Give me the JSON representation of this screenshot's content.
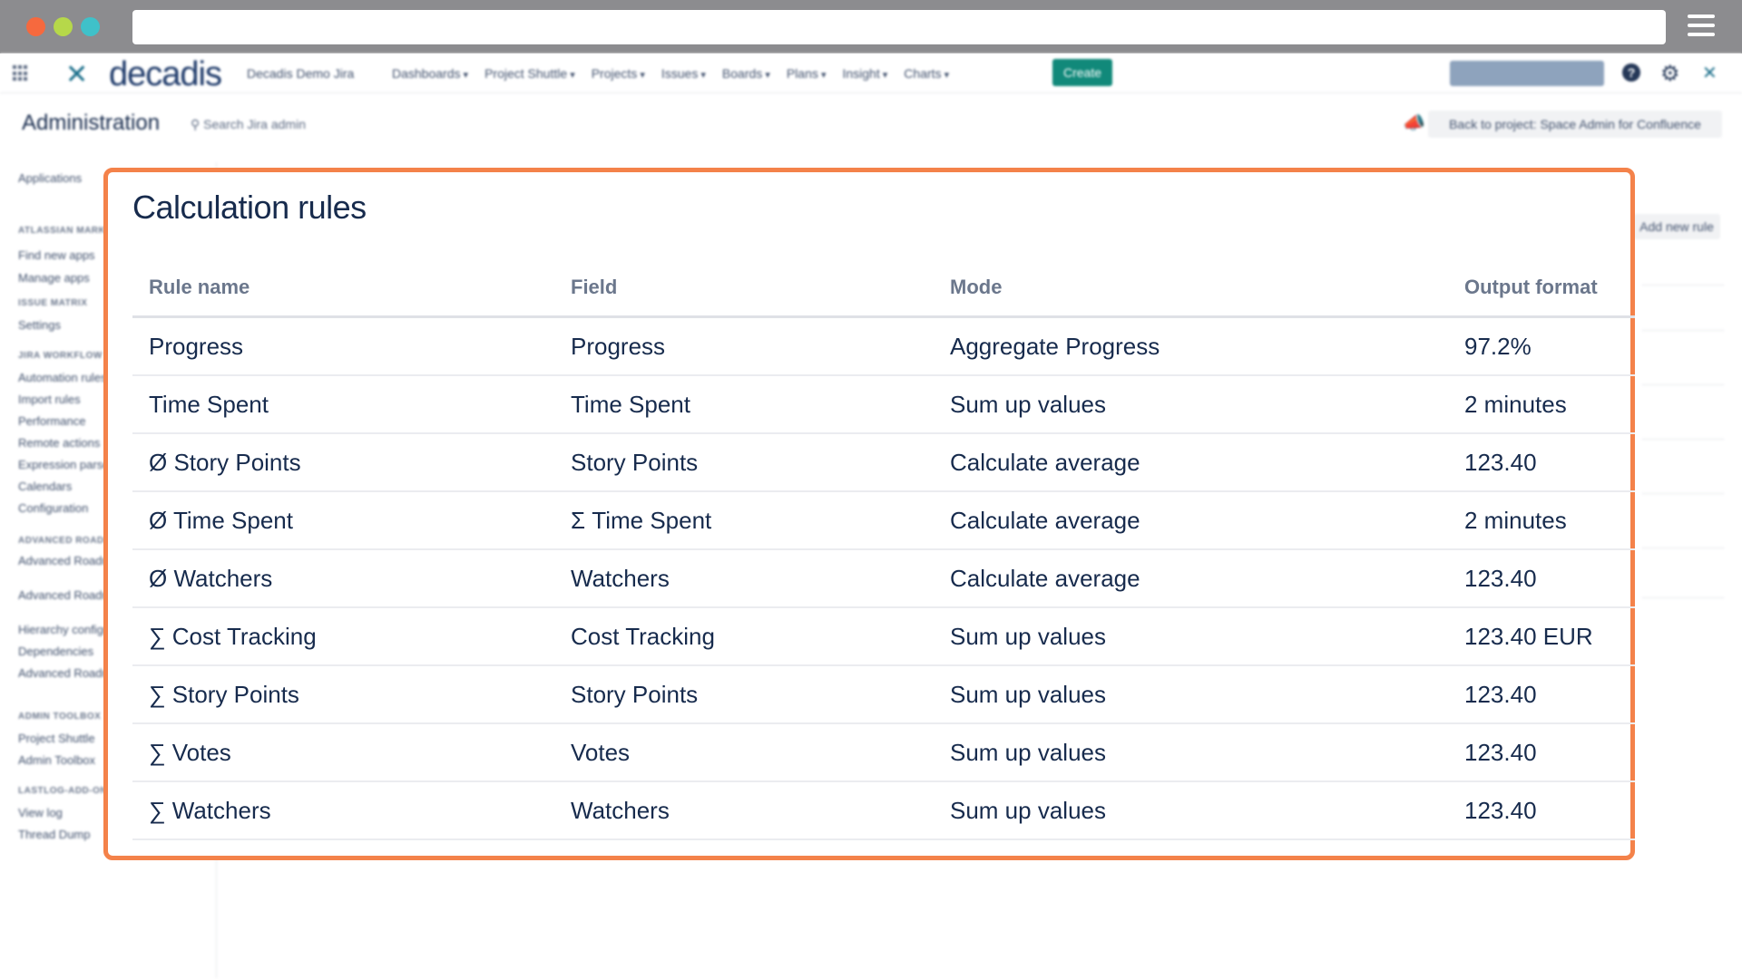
{
  "jira": {
    "instance_name": "Decadis Demo Jira",
    "logo_text": "decadis",
    "nav_items": [
      "Dashboards",
      "Project Shuttle",
      "Projects",
      "Issues",
      "Boards",
      "Plans",
      "Insight",
      "Charts"
    ],
    "create_label": "Create",
    "page_title": "Administration",
    "admin_search_label": "Search Jira admin",
    "back_link_label": "Back to project: Space Admin for Confluence",
    "add_rule_label": "Add new rule",
    "sidebar": [
      {
        "label": "Applications",
        "header": false
      },
      {
        "label": "ATLASSIAN MARKETPLACE",
        "header": true
      },
      {
        "label": "Find new apps",
        "header": false
      },
      {
        "label": "Manage apps",
        "header": false
      },
      {
        "label": "ISSUE MATRIX",
        "header": true
      },
      {
        "label": "Settings",
        "header": false
      },
      {
        "label": "JIRA WORKFLOW",
        "header": true
      },
      {
        "label": "Automation rules",
        "header": false
      },
      {
        "label": "Import rules",
        "header": false
      },
      {
        "label": "Performance",
        "header": false
      },
      {
        "label": "Remote actions",
        "header": false
      },
      {
        "label": "Expression parser",
        "header": false
      },
      {
        "label": "Calendars",
        "header": false
      },
      {
        "label": "Configuration",
        "header": false
      },
      {
        "label": "ADVANCED ROADMAPS",
        "header": true
      },
      {
        "label": "Advanced Roadmaps permissions",
        "header": false
      },
      {
        "label": "Advanced Roadmaps details",
        "header": false
      },
      {
        "label": "Hierarchy configuration",
        "header": false
      },
      {
        "label": "Dependencies",
        "header": false
      },
      {
        "label": "Advanced Roadmaps access features",
        "header": false
      },
      {
        "label": "ADMIN TOOLBOX",
        "header": true
      },
      {
        "label": "Project Shuttle",
        "header": false
      },
      {
        "label": "Admin Toolbox",
        "header": false
      },
      {
        "label": "LASTLOG-ADD-ON",
        "header": true
      },
      {
        "label": "View log",
        "header": false
      },
      {
        "label": "Thread Dump",
        "header": false
      }
    ]
  },
  "panel": {
    "title": "Calculation rules",
    "columns": [
      "Rule name",
      "Field",
      "Mode",
      "Output format"
    ],
    "rows": [
      [
        "Progress",
        "Progress",
        "Aggregate Progress",
        "97.2%"
      ],
      [
        "Time Spent",
        "Time Spent",
        "Sum up values",
        "2 minutes"
      ],
      [
        "Ø Story Points",
        "Story Points",
        "Calculate average",
        "123.40"
      ],
      [
        "Ø Time Spent",
        "Σ Time Spent",
        "Calculate average",
        "2 minutes"
      ],
      [
        "Ø Watchers",
        "Watchers",
        "Calculate average",
        "123.40"
      ],
      [
        "∑ Cost Tracking",
        "Cost Tracking",
        "Sum up values",
        "123.40 EUR"
      ],
      [
        "∑ Story Points",
        "Story Points",
        "Sum up values",
        "123.40"
      ],
      [
        "∑ Votes",
        "Votes",
        "Sum up values",
        "123.40"
      ],
      [
        "∑ Watchers",
        "Watchers",
        "Sum up values",
        "123.40"
      ]
    ]
  },
  "colors": {
    "highlight_border": "#f4824a",
    "create_button": "#11897a",
    "text_primary": "#172b4d",
    "text_secondary": "#6b778c"
  }
}
